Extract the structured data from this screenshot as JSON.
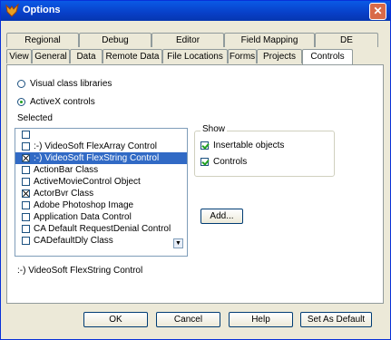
{
  "window": {
    "title": "Options",
    "close_glyph": "✕"
  },
  "tabs": {
    "back_row": [
      "Regional",
      "Debug",
      "Editor",
      "Field Mapping",
      "DE"
    ],
    "front_row": [
      "View",
      "General",
      "Data",
      "Remote Data",
      "File Locations",
      "Forms",
      "Projects",
      "Controls"
    ],
    "active": "Controls"
  },
  "controls_page": {
    "radio_visual_class": "Visual class libraries",
    "radio_activex": "ActiveX controls",
    "selected_label": "Selected",
    "list_items": [
      {
        "label": "",
        "checked": false,
        "selected": false
      },
      {
        "label": ":-) VideoSoft FlexArray Control",
        "checked": false,
        "selected": false
      },
      {
        "label": ":-) VideoSoft FlexString Control",
        "checked": true,
        "selected": true
      },
      {
        "label": "ActionBar Class",
        "checked": false,
        "selected": false
      },
      {
        "label": "ActiveMovieControl Object",
        "checked": false,
        "selected": false
      },
      {
        "label": "ActorBvr Class",
        "checked": true,
        "selected": false
      },
      {
        "label": "Adobe Photoshop Image",
        "checked": false,
        "selected": false
      },
      {
        "label": "Application Data Control",
        "checked": false,
        "selected": false
      },
      {
        "label": "CA Default RequestDenial Control",
        "checked": false,
        "selected": false
      },
      {
        "label": "CADefaultDly Class",
        "checked": false,
        "selected": false
      }
    ],
    "show_group_title": "Show",
    "show_insertable": "Insertable objects",
    "show_controls": "Controls",
    "add_button": "Add...",
    "status_text": ":-) VideoSoft FlexString Control"
  },
  "buttons": {
    "ok": "OK",
    "cancel": "Cancel",
    "help": "Help",
    "set_as_default": "Set As Default"
  }
}
